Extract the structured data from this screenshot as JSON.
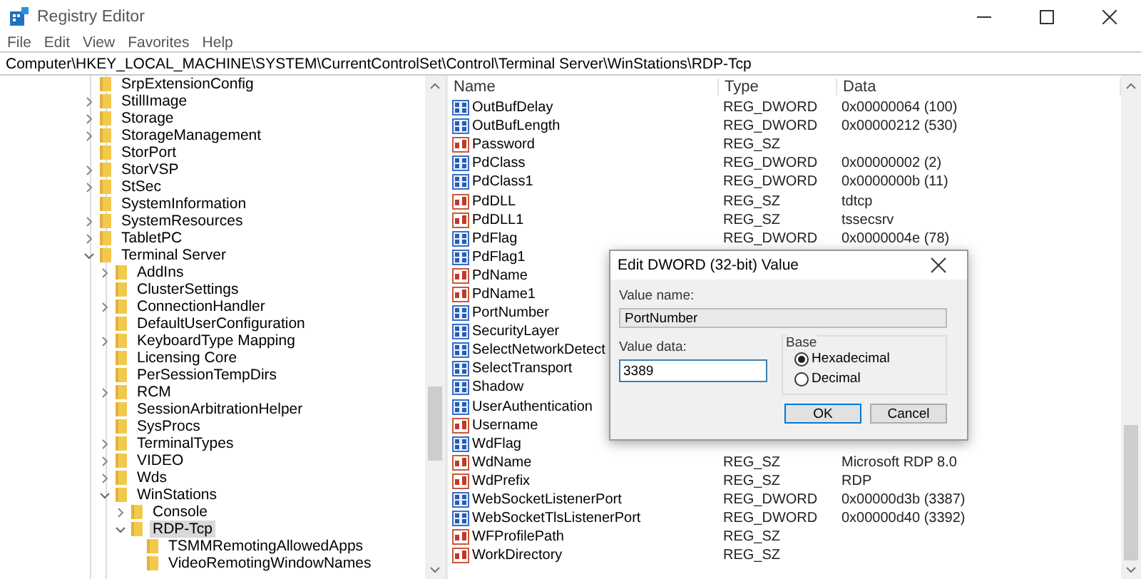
{
  "window": {
    "title": "Registry Editor"
  },
  "menu": [
    "File",
    "Edit",
    "View",
    "Favorites",
    "Help"
  ],
  "address": "Computer\\HKEY_LOCAL_MACHINE\\SYSTEM\\CurrentControlSet\\Control\\Terminal Server\\WinStations\\RDP-Tcp",
  "tree": [
    {
      "label": "SrpExtensionConfig",
      "selected": false
    },
    {
      "label": "StillImage",
      "expanded": false,
      "selected": false
    },
    {
      "label": "Storage",
      "expanded": false,
      "selected": false
    },
    {
      "label": "StorageManagement",
      "expanded": false,
      "selected": false
    },
    {
      "label": "StorPort",
      "selected": false
    },
    {
      "label": "StorVSP",
      "expanded": false,
      "selected": false
    },
    {
      "label": "StSec",
      "expanded": false,
      "selected": false
    },
    {
      "label": "SystemInformation",
      "selected": false
    },
    {
      "label": "SystemResources",
      "expanded": false,
      "selected": false
    },
    {
      "label": "TabletPC",
      "expanded": false,
      "selected": false
    },
    {
      "label": "Terminal Server",
      "expanded": true,
      "selected": false,
      "children": [
        {
          "label": "AddIns",
          "expanded": false,
          "selected": false
        },
        {
          "label": "ClusterSettings",
          "selected": false
        },
        {
          "label": "ConnectionHandler",
          "expanded": false,
          "selected": false
        },
        {
          "label": "DefaultUserConfiguration",
          "selected": false
        },
        {
          "label": "KeyboardType Mapping",
          "expanded": false,
          "selected": false
        },
        {
          "label": "Licensing Core",
          "selected": false
        },
        {
          "label": "PerSessionTempDirs",
          "selected": false
        },
        {
          "label": "RCM",
          "expanded": false,
          "selected": false
        },
        {
          "label": "SessionArbitrationHelper",
          "selected": false
        },
        {
          "label": "SysProcs",
          "selected": false
        },
        {
          "label": "TerminalTypes",
          "expanded": false,
          "selected": false
        },
        {
          "label": "VIDEO",
          "expanded": false,
          "selected": false
        },
        {
          "label": "Wds",
          "expanded": false,
          "selected": false
        },
        {
          "label": "WinStations",
          "expanded": true,
          "selected": false,
          "children": [
            {
              "label": "Console",
              "expanded": false,
              "selected": false
            },
            {
              "label": "RDP-Tcp",
              "expanded": true,
              "selected": true,
              "children": [
                {
                  "label": "TSMMRemotingAllowedApps",
                  "selected": false
                },
                {
                  "label": "VideoRemotingWindowNames",
                  "selected": false
                }
              ]
            }
          ]
        }
      ]
    }
  ],
  "values": {
    "columns": [
      "Name",
      "Type",
      "Data"
    ],
    "rows": [
      {
        "kind": "dword",
        "name": "OutBufDelay",
        "type": "REG_DWORD",
        "data": "0x00000064 (100)"
      },
      {
        "kind": "dword",
        "name": "OutBufLength",
        "type": "REG_DWORD",
        "data": "0x00000212 (530)"
      },
      {
        "kind": "sz",
        "name": "Password",
        "type": "REG_SZ"
      },
      {
        "kind": "dword",
        "name": "PdClass",
        "type": "REG_DWORD",
        "data": "0x00000002 (2)"
      },
      {
        "kind": "dword",
        "name": "PdClass1",
        "type": "REG_DWORD",
        "data": "0x0000000b (11)"
      },
      {
        "kind": "sz",
        "name": "PdDLL",
        "type": "REG_SZ",
        "data": "tdtcp"
      },
      {
        "kind": "sz",
        "name": "PdDLL1",
        "type": "REG_SZ",
        "data": "tssecsrv"
      },
      {
        "kind": "dword",
        "name": "PdFlag",
        "type": "REG_DWORD",
        "data": "0x0000004e (78)"
      },
      {
        "kind": "dword",
        "name": "PdFlag1"
      },
      {
        "kind": "sz",
        "name": "PdName"
      },
      {
        "kind": "sz",
        "name": "PdName1"
      },
      {
        "kind": "dword",
        "name": "PortNumber"
      },
      {
        "kind": "dword",
        "name": "SecurityLayer"
      },
      {
        "kind": "dword",
        "name": "SelectNetworkDetect"
      },
      {
        "kind": "dword",
        "name": "SelectTransport"
      },
      {
        "kind": "dword",
        "name": "Shadow"
      },
      {
        "kind": "dword",
        "name": "UserAuthentication"
      },
      {
        "kind": "sz",
        "name": "Username"
      },
      {
        "kind": "dword",
        "name": "WdFlag"
      },
      {
        "kind": "sz",
        "name": "WdName",
        "type": "REG_SZ",
        "data": "Microsoft RDP 8.0"
      },
      {
        "kind": "sz",
        "name": "WdPrefix",
        "type": "REG_SZ",
        "data": "RDP"
      },
      {
        "kind": "dword",
        "name": "WebSocketListenerPort",
        "type": "REG_DWORD",
        "data": "0x00000d3b (3387)"
      },
      {
        "kind": "dword",
        "name": "WebSocketTlsListenerPort",
        "type": "REG_DWORD",
        "data": "0x00000d40 (3392)"
      },
      {
        "kind": "sz",
        "name": "WFProfilePath",
        "type": "REG_SZ"
      },
      {
        "kind": "sz",
        "name": "WorkDirectory",
        "type": "REG_SZ"
      }
    ]
  },
  "dialog": {
    "title": "Edit DWORD (32-bit) Value",
    "value_name_label": "Value name:",
    "value_name": "PortNumber",
    "value_data_label": "Value data:",
    "value_data": "3389",
    "base_label": "Base",
    "bases": [
      {
        "label": "Hexadecimal",
        "selected": true
      },
      {
        "label": "Decimal",
        "selected": false
      }
    ],
    "buttons": [
      "OK",
      "Cancel"
    ]
  }
}
